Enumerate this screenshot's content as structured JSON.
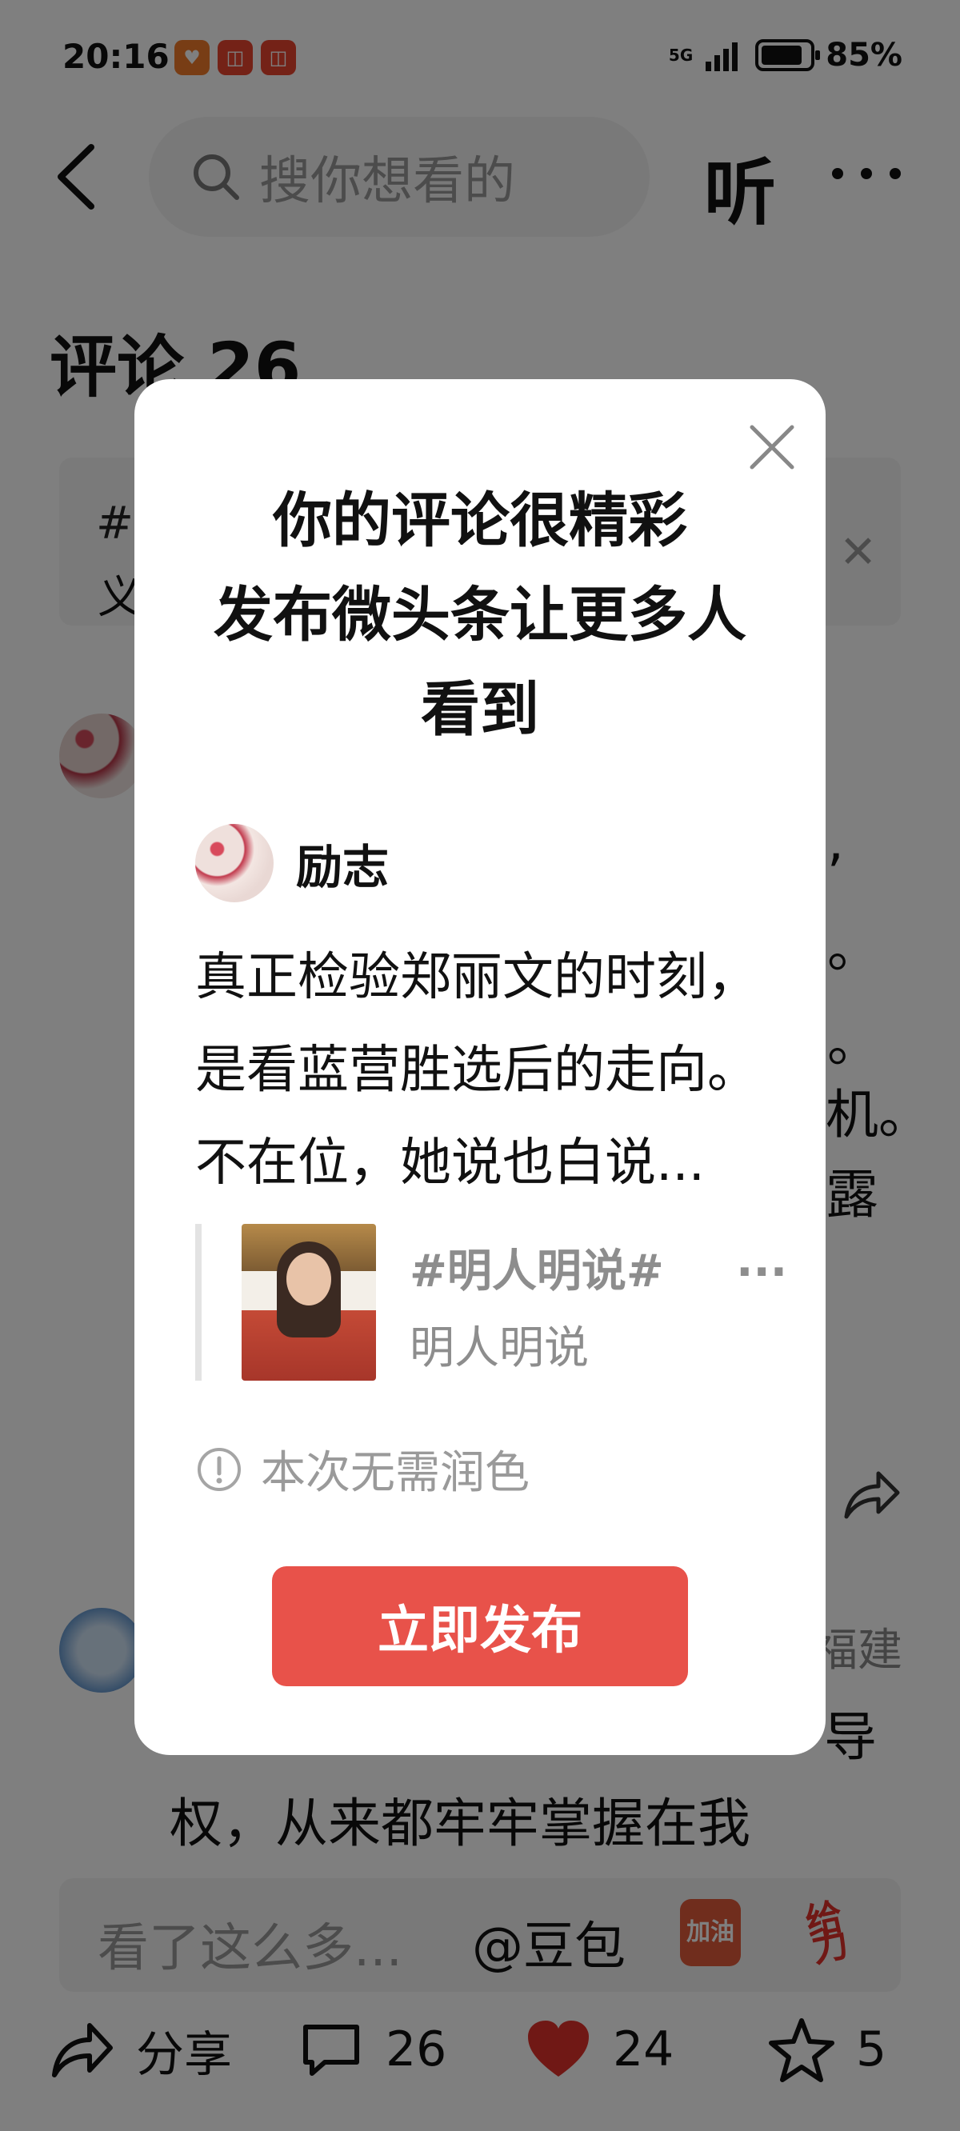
{
  "status_bar": {
    "time": "20:16",
    "network": "5G",
    "battery": "85%"
  },
  "header": {
    "search_placeholder": "搜你想看的",
    "listen_label": "听"
  },
  "comments": {
    "title": "评论 26",
    "topic_banner_fragment": "义",
    "comment1_visible_right": [
      ",",
      "。",
      "。",
      "机。",
      "露"
    ],
    "comment2_province": "福建",
    "comment2_line_end": "导",
    "comment2_line": "权，从来都牢牢掌握在我"
  },
  "input_bar": {
    "placeholder": "看了这么多...",
    "mention": "@豆包",
    "sticker1": "加油",
    "sticker2": "给力"
  },
  "bottom_bar": {
    "share_label": "分享",
    "comment_count": "26",
    "like_count": "24",
    "star_count": "5"
  },
  "modal": {
    "title_lines": [
      "你的评论很精彩",
      "发布微头条让更多人",
      "看到"
    ],
    "author": "励志",
    "body_lines": [
      "真正检验郑丽文的时刻，",
      "是看蓝营胜选后的走向。",
      "不在位，她说也白说..."
    ],
    "quote_title": "#明人明说#",
    "quote_ellipsis": "...",
    "quote_subtitle": "明人明说",
    "hint": "本次无需润色",
    "publish_button": "立即发布"
  },
  "colors": {
    "accent": "#e8524a",
    "like": "#e0312a"
  }
}
